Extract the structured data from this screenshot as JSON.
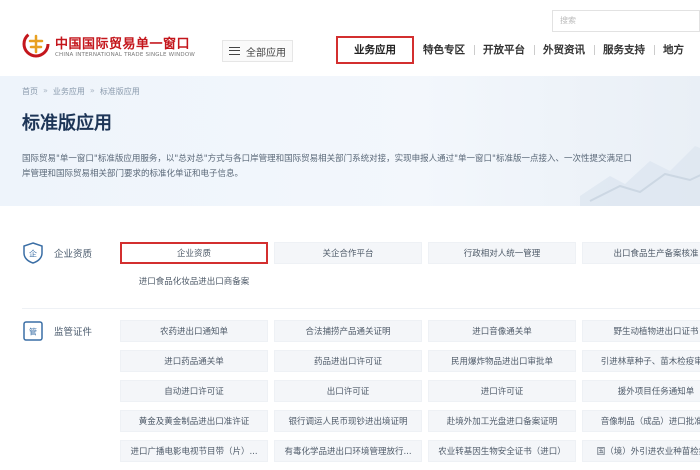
{
  "header": {
    "logo_cn": "中国国际贸易单一窗口",
    "logo_en": "CHINA INTERNATIONAL TRADE SINGLE WINDOW",
    "menu_label": "全部应用",
    "search_placeholder": "搜索",
    "nav": [
      "业务应用",
      "特色专区",
      "开放平台",
      "外贸资讯",
      "服务支持",
      "地方"
    ],
    "active_nav": "业务应用",
    "brand_color": "#c4161c",
    "highlight_color": "#d32f2f"
  },
  "banner": {
    "breadcrumb": [
      "首页",
      "业务应用",
      "标准版应用"
    ],
    "title": "标准版应用",
    "intro": "国际贸易\"单一窗口\"标准版应用服务，以\"总对总\"方式与各口岸管理和国际贸易相关部门系统对接，实现申报人通过\"单一窗口\"标准版一点接入、一次性提交满足口岸管理和国际贸易相关部门要求的标准化单证和电子信息。"
  },
  "sections": [
    {
      "label": "企业资质",
      "icon": "enterprise-shield-icon",
      "items": [
        "企业资质",
        "关企合作平台",
        "行政相对人统一管理",
        "出口食品生产备案核准",
        "进口食品化妆品进出口商备案"
      ]
    },
    {
      "label": "监管证件",
      "icon": "license-document-icon",
      "items": [
        "农药进出口通知单",
        "合法捕捞产品通关证明",
        "进口音像通关单",
        "野生动植物进出口证书",
        "进口药品通关单",
        "药品进出口许可证",
        "民用爆炸物品进出口审批单",
        "引进林草种子、苗木检疫审批",
        "自动进口许可证",
        "出口许可证",
        "进口许可证",
        "援外项目任务通知单",
        "黄金及黄金制品进出口准许证",
        "银行调运人民币现钞进出境证明",
        "赴境外加工光盘进口备案证明",
        "音像制品（成品）进口批准单",
        "进口广播电影电视节目带（片）...",
        "有毒化学品进出口环境管理放行...",
        "农业转基因生物安全证书（进口）",
        "国（境）外引进农业种苗检疫..."
      ]
    }
  ]
}
